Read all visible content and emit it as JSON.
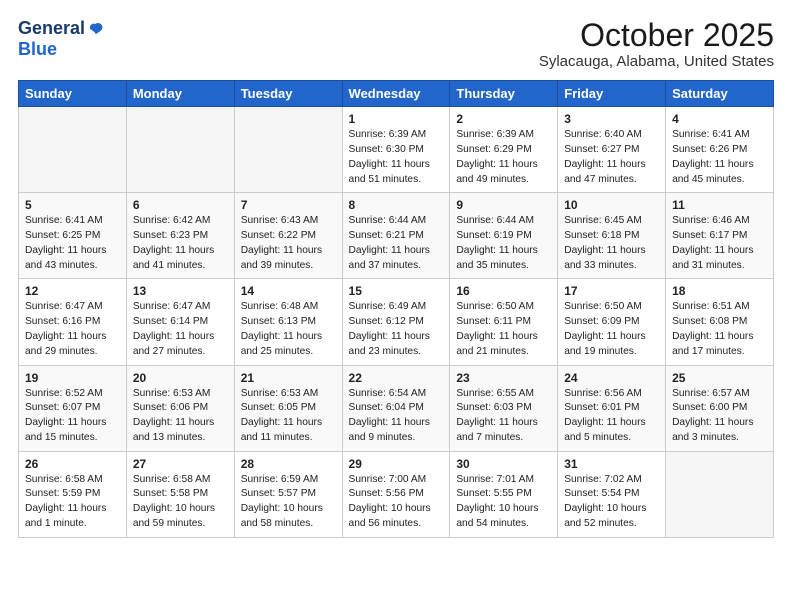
{
  "logo": {
    "general": "General",
    "blue": "Blue"
  },
  "header": {
    "month": "October 2025",
    "location": "Sylacauga, Alabama, United States"
  },
  "weekdays": [
    "Sunday",
    "Monday",
    "Tuesday",
    "Wednesday",
    "Thursday",
    "Friday",
    "Saturday"
  ],
  "weeks": [
    [
      {
        "day": "",
        "content": ""
      },
      {
        "day": "",
        "content": ""
      },
      {
        "day": "",
        "content": ""
      },
      {
        "day": "1",
        "content": "Sunrise: 6:39 AM\nSunset: 6:30 PM\nDaylight: 11 hours and 51 minutes."
      },
      {
        "day": "2",
        "content": "Sunrise: 6:39 AM\nSunset: 6:29 PM\nDaylight: 11 hours and 49 minutes."
      },
      {
        "day": "3",
        "content": "Sunrise: 6:40 AM\nSunset: 6:27 PM\nDaylight: 11 hours and 47 minutes."
      },
      {
        "day": "4",
        "content": "Sunrise: 6:41 AM\nSunset: 6:26 PM\nDaylight: 11 hours and 45 minutes."
      }
    ],
    [
      {
        "day": "5",
        "content": "Sunrise: 6:41 AM\nSunset: 6:25 PM\nDaylight: 11 hours and 43 minutes."
      },
      {
        "day": "6",
        "content": "Sunrise: 6:42 AM\nSunset: 6:23 PM\nDaylight: 11 hours and 41 minutes."
      },
      {
        "day": "7",
        "content": "Sunrise: 6:43 AM\nSunset: 6:22 PM\nDaylight: 11 hours and 39 minutes."
      },
      {
        "day": "8",
        "content": "Sunrise: 6:44 AM\nSunset: 6:21 PM\nDaylight: 11 hours and 37 minutes."
      },
      {
        "day": "9",
        "content": "Sunrise: 6:44 AM\nSunset: 6:19 PM\nDaylight: 11 hours and 35 minutes."
      },
      {
        "day": "10",
        "content": "Sunrise: 6:45 AM\nSunset: 6:18 PM\nDaylight: 11 hours and 33 minutes."
      },
      {
        "day": "11",
        "content": "Sunrise: 6:46 AM\nSunset: 6:17 PM\nDaylight: 11 hours and 31 minutes."
      }
    ],
    [
      {
        "day": "12",
        "content": "Sunrise: 6:47 AM\nSunset: 6:16 PM\nDaylight: 11 hours and 29 minutes."
      },
      {
        "day": "13",
        "content": "Sunrise: 6:47 AM\nSunset: 6:14 PM\nDaylight: 11 hours and 27 minutes."
      },
      {
        "day": "14",
        "content": "Sunrise: 6:48 AM\nSunset: 6:13 PM\nDaylight: 11 hours and 25 minutes."
      },
      {
        "day": "15",
        "content": "Sunrise: 6:49 AM\nSunset: 6:12 PM\nDaylight: 11 hours and 23 minutes."
      },
      {
        "day": "16",
        "content": "Sunrise: 6:50 AM\nSunset: 6:11 PM\nDaylight: 11 hours and 21 minutes."
      },
      {
        "day": "17",
        "content": "Sunrise: 6:50 AM\nSunset: 6:09 PM\nDaylight: 11 hours and 19 minutes."
      },
      {
        "day": "18",
        "content": "Sunrise: 6:51 AM\nSunset: 6:08 PM\nDaylight: 11 hours and 17 minutes."
      }
    ],
    [
      {
        "day": "19",
        "content": "Sunrise: 6:52 AM\nSunset: 6:07 PM\nDaylight: 11 hours and 15 minutes."
      },
      {
        "day": "20",
        "content": "Sunrise: 6:53 AM\nSunset: 6:06 PM\nDaylight: 11 hours and 13 minutes."
      },
      {
        "day": "21",
        "content": "Sunrise: 6:53 AM\nSunset: 6:05 PM\nDaylight: 11 hours and 11 minutes."
      },
      {
        "day": "22",
        "content": "Sunrise: 6:54 AM\nSunset: 6:04 PM\nDaylight: 11 hours and 9 minutes."
      },
      {
        "day": "23",
        "content": "Sunrise: 6:55 AM\nSunset: 6:03 PM\nDaylight: 11 hours and 7 minutes."
      },
      {
        "day": "24",
        "content": "Sunrise: 6:56 AM\nSunset: 6:01 PM\nDaylight: 11 hours and 5 minutes."
      },
      {
        "day": "25",
        "content": "Sunrise: 6:57 AM\nSunset: 6:00 PM\nDaylight: 11 hours and 3 minutes."
      }
    ],
    [
      {
        "day": "26",
        "content": "Sunrise: 6:58 AM\nSunset: 5:59 PM\nDaylight: 11 hours and 1 minute."
      },
      {
        "day": "27",
        "content": "Sunrise: 6:58 AM\nSunset: 5:58 PM\nDaylight: 10 hours and 59 minutes."
      },
      {
        "day": "28",
        "content": "Sunrise: 6:59 AM\nSunset: 5:57 PM\nDaylight: 10 hours and 58 minutes."
      },
      {
        "day": "29",
        "content": "Sunrise: 7:00 AM\nSunset: 5:56 PM\nDaylight: 10 hours and 56 minutes."
      },
      {
        "day": "30",
        "content": "Sunrise: 7:01 AM\nSunset: 5:55 PM\nDaylight: 10 hours and 54 minutes."
      },
      {
        "day": "31",
        "content": "Sunrise: 7:02 AM\nSunset: 5:54 PM\nDaylight: 10 hours and 52 minutes."
      },
      {
        "day": "",
        "content": ""
      }
    ]
  ]
}
